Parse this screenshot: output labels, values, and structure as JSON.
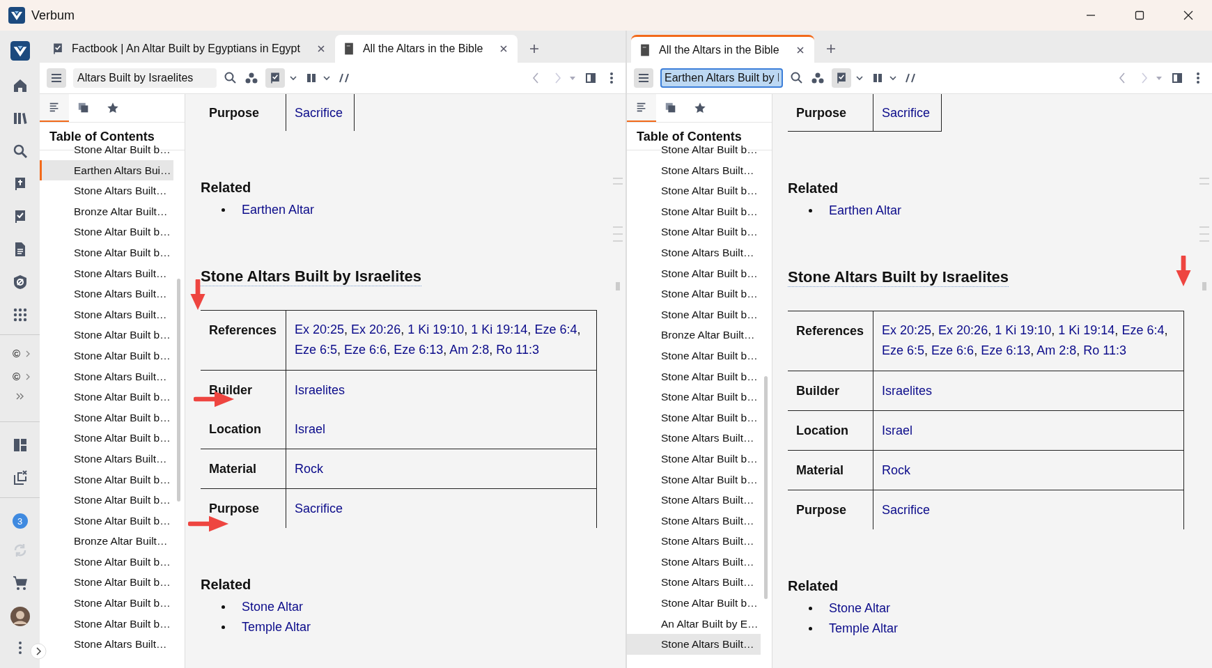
{
  "window": {
    "title": "Verbum"
  },
  "rail": {
    "copyright_items": [
      "©",
      "©"
    ],
    "badge": "3"
  },
  "panes": [
    {
      "focused": false,
      "tabs": [
        {
          "title": "Factbook | An Altar Built by Egyptians in Egypt",
          "kind": "factbook",
          "selected": false
        },
        {
          "title": "All the Altars in the Bible",
          "kind": "book",
          "selected": true
        }
      ],
      "toolbar": {
        "search_value": "Altars Built by Israelites",
        "search_focused": false,
        "interlinear_on": true
      },
      "toc": {
        "panel_tabs": [
          {
            "kind": "contents",
            "selected": true
          },
          {
            "kind": "copies",
            "selected": false
          },
          {
            "kind": "favorites",
            "selected": false
          }
        ],
        "title": "Table of Contents",
        "marker_bar": true,
        "items": [
          {
            "label": "Stone Altar Built b…",
            "selected": false
          },
          {
            "label": "Earthen Altars Bui…",
            "selected": true
          },
          {
            "label": "Stone Altars Built…",
            "selected": false
          },
          {
            "label": "Bronze Altar Built…",
            "selected": false
          },
          {
            "label": "Stone Altar Built b…",
            "selected": false
          },
          {
            "label": "Stone Altar Built b…",
            "selected": false
          },
          {
            "label": "Stone Altars Built…",
            "selected": false
          },
          {
            "label": "Stone Altars Built…",
            "selected": false
          },
          {
            "label": "Stone Altars Built…",
            "selected": false
          },
          {
            "label": "Stone Altar Built b…",
            "selected": false
          },
          {
            "label": "Stone Altar Built b…",
            "selected": false
          },
          {
            "label": "Stone Altars Built…",
            "selected": false
          },
          {
            "label": "Stone Altar Built b…",
            "selected": false
          },
          {
            "label": "Stone Altar Built b…",
            "selected": false
          },
          {
            "label": "Stone Altar Built b…",
            "selected": false
          },
          {
            "label": "Stone Altars Built…",
            "selected": false
          },
          {
            "label": "Stone Altar Built b…",
            "selected": false
          },
          {
            "label": "Stone Altar Built b…",
            "selected": false
          },
          {
            "label": "Stone Altar Built b…",
            "selected": false
          },
          {
            "label": "Bronze Altar Built…",
            "selected": false
          },
          {
            "label": "Stone Altar Built b…",
            "selected": false
          },
          {
            "label": "Stone Altar Built b…",
            "selected": false
          },
          {
            "label": "Stone Altar Built b…",
            "selected": false
          },
          {
            "label": "Stone Altar Built b…",
            "selected": false
          },
          {
            "label": "Stone Altars Built…",
            "selected": false
          }
        ]
      },
      "document": [
        {
          "kind": "fragment",
          "separator": ",",
          "rows": [
            {
              "label": "Purpose",
              "links": [
                "Sacrifice"
              ],
              "rule_below": false
            }
          ]
        },
        {
          "kind": "related",
          "heading": "Related",
          "links": [
            "Earthen Altar"
          ]
        },
        {
          "kind": "factbox",
          "heading": "Stone Altars Built by Israelites",
          "rows": [
            {
              "label": "References",
              "links": [
                "Ex 20:25",
                "Ex 20:26",
                "1 Ki 19:10",
                "1 Ki 19:14",
                "Eze 6:4",
                "Eze 6:5",
                "Eze 6:6",
                "Eze 6:13",
                "Am 2:8",
                "Ro 11:3"
              ],
              "rule_below": true
            },
            {
              "label": "Builder",
              "links": [
                "Israelites"
              ],
              "rule_below": false
            },
            {
              "label": "Location",
              "links": [
                "Israel"
              ],
              "rule_below": true
            },
            {
              "label": "Material",
              "links": [
                "Rock"
              ],
              "rule_below": true
            },
            {
              "label": "Purpose",
              "links": [
                "Sacrifice"
              ],
              "rule_below": false
            }
          ]
        },
        {
          "kind": "related",
          "heading": "Related",
          "links": [
            "Stone Altar",
            "Temple Altar"
          ]
        }
      ]
    },
    {
      "focused": true,
      "tabs": [
        {
          "title": "All the Altars in the Bible",
          "kind": "book",
          "selected": true
        }
      ],
      "toolbar": {
        "search_value": "Earthen Altars Built by I",
        "search_focused": true,
        "interlinear_on": true
      },
      "toc": {
        "panel_tabs": [
          {
            "kind": "contents",
            "selected": true
          },
          {
            "kind": "copies",
            "selected": false
          },
          {
            "kind": "favorites",
            "selected": false
          }
        ],
        "title": "Table of Contents",
        "marker_bar": false,
        "items": [
          {
            "label": "Stone Altar Built b…",
            "selected": false
          },
          {
            "label": "Stone Altars Built…",
            "selected": false
          },
          {
            "label": "Stone Altar Built b…",
            "selected": false
          },
          {
            "label": "Stone Altar Built b…",
            "selected": false
          },
          {
            "label": "Stone Altar Built b…",
            "selected": false
          },
          {
            "label": "Stone Altars Built…",
            "selected": false
          },
          {
            "label": "Stone Altar Built b…",
            "selected": false
          },
          {
            "label": "Stone Altar Built b…",
            "selected": false
          },
          {
            "label": "Stone Altar Built b…",
            "selected": false
          },
          {
            "label": "Bronze Altar Built…",
            "selected": false
          },
          {
            "label": "Stone Altar Built b…",
            "selected": false
          },
          {
            "label": "Stone Altar Built b…",
            "selected": false
          },
          {
            "label": "Stone Altar Built b…",
            "selected": false
          },
          {
            "label": "Stone Altar Built b…",
            "selected": false
          },
          {
            "label": "Stone Altars Built…",
            "selected": false
          },
          {
            "label": "Stone Altar Built b…",
            "selected": false
          },
          {
            "label": "Stone Altar Built b…",
            "selected": false
          },
          {
            "label": "Stone Altars Built…",
            "selected": false
          },
          {
            "label": "Stone Altars Built…",
            "selected": false
          },
          {
            "label": "Stone Altars Built…",
            "selected": false
          },
          {
            "label": "Stone Altars Built…",
            "selected": false
          },
          {
            "label": "Stone Altars Built…",
            "selected": false
          },
          {
            "label": "Stone Altar Built b…",
            "selected": false
          },
          {
            "label": "An Altar Built by E…",
            "selected": false
          },
          {
            "label": "Stone Altars Built…",
            "selected": true
          }
        ]
      },
      "document": [
        {
          "kind": "fragment",
          "separator": ",",
          "rows": [
            {
              "label": "Purpose",
              "links": [
                "Sacrifice"
              ],
              "rule_below": true
            }
          ]
        },
        {
          "kind": "related",
          "heading": "Related",
          "links": [
            "Earthen Altar"
          ]
        },
        {
          "kind": "factbox",
          "heading": "Stone Altars Built by Israelites",
          "rows": [
            {
              "label": "References",
              "links": [
                "Ex 20:25",
                "Ex 20:26",
                "1 Ki 19:10",
                "1 Ki 19:14",
                "Eze 6:4",
                "Eze 6:5",
                "Eze 6:6",
                "Eze 6:13",
                "Am 2:8",
                "Ro 11:3"
              ],
              "rule_below": true
            },
            {
              "label": "Builder",
              "links": [
                "Israelites"
              ],
              "rule_below": true
            },
            {
              "label": "Location",
              "links": [
                "Israel"
              ],
              "rule_below": true
            },
            {
              "label": "Material",
              "links": [
                "Rock"
              ],
              "rule_below": true
            },
            {
              "label": "Purpose",
              "links": [
                "Sacrifice"
              ],
              "rule_below": false
            }
          ]
        },
        {
          "kind": "related",
          "heading": "Related",
          "links": [
            "Stone Altar",
            "Temple Altar"
          ]
        }
      ]
    }
  ]
}
